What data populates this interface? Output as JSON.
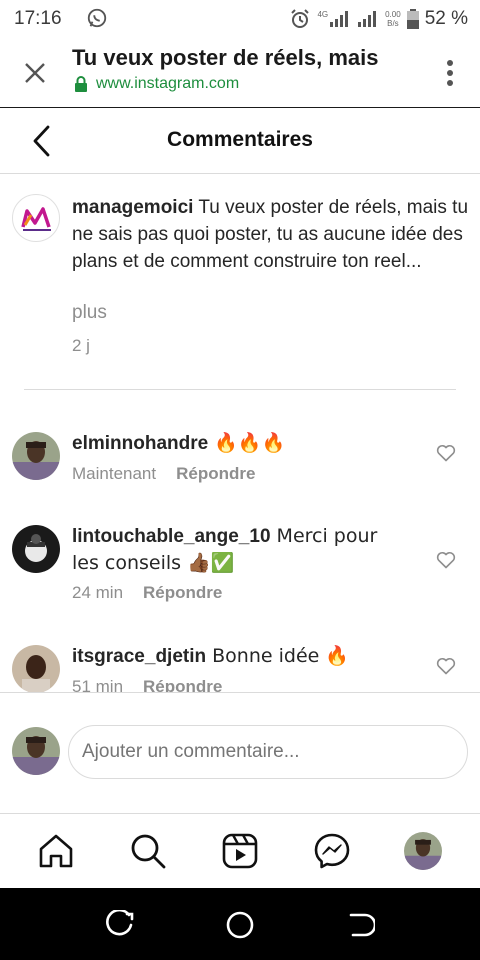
{
  "status_bar": {
    "time": "17:16",
    "network": "4G",
    "data_speed_top": "0.00",
    "data_speed_bottom": "B/s",
    "battery": "52 %"
  },
  "browser": {
    "page_title": "Tu veux poster de réels, mais",
    "url": "www.instagram.com"
  },
  "header": {
    "title": "Commentaires"
  },
  "caption": {
    "username": "managemoici",
    "text": " Tu veux poster de réels, mais tu ne sais pas quoi poster, tu as aucune idée des plans et de comment construire ton reel...",
    "more": "plus",
    "time": "2 j"
  },
  "comments": [
    {
      "username": "elminnohandre",
      "text": " 🔥🔥🔥",
      "time": "Maintenant",
      "reply": "Répondre"
    },
    {
      "username": "lintouchable_ange_10",
      "text": " Merci pour les conseils 👍🏾✅",
      "time": "24 min",
      "reply": "Répondre"
    },
    {
      "username": "itsgrace_djetin",
      "text": " Bonne idée 🔥",
      "time": "51 min",
      "reply": "Répondre"
    }
  ],
  "comment_input": {
    "placeholder": "Ajouter un commentaire..."
  },
  "colors": {
    "url_green": "#1e8e3e",
    "muted_text": "#8e8e8e",
    "divider": "#dbdbdb"
  },
  "icons": {
    "bottom_nav": [
      "home-icon",
      "search-icon",
      "reels-icon",
      "messenger-icon",
      "profile-avatar"
    ]
  }
}
